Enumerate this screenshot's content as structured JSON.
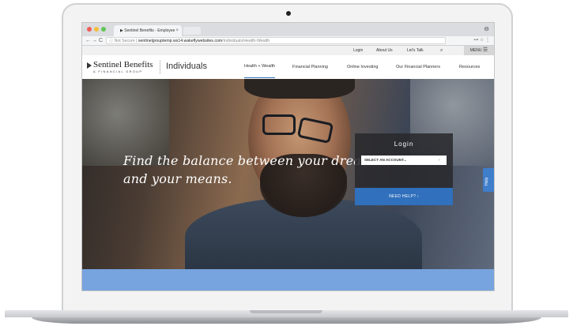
{
  "browser": {
    "tab_title": "Sentinel Benefits - Employee",
    "tab_close": "×",
    "url_security": "Not Secure",
    "url_host": "sentinelgrouptemp.ws14.wakeflywebsites.com",
    "url_path": "/individuals/Health-Wealth",
    "nav_back": "←",
    "nav_forward": "→",
    "nav_reload": "C",
    "info_icon": "ⓘ",
    "profile_icon": "⊖",
    "ext_icons": "⊶ ☆ ⋮"
  },
  "utility": {
    "login": "Login",
    "about": "About Us",
    "talk": "Let's Talk",
    "search_icon": "🔍",
    "menu": "MENU",
    "menu_icon": "☰"
  },
  "header": {
    "logo_name": "Sentinel Benefits",
    "logo_sub": "& FINANCIAL GROUP",
    "section": "Individuals",
    "nav": [
      "Health + Wealth",
      "Financial Planning",
      "Online Investing",
      "Our Financial Planners",
      "Resources"
    ]
  },
  "hero": {
    "headline_line1": "Find the balance between your dreams",
    "headline_line2": "and your means."
  },
  "login": {
    "title": "Login",
    "select_value": "SELECT AN ACCOUNT...",
    "select_clear": "×",
    "need_help": "NEED HELP? ›"
  },
  "help_tab": "Help",
  "colors": {
    "accent": "#3070bc",
    "strip": "#77a4df"
  }
}
